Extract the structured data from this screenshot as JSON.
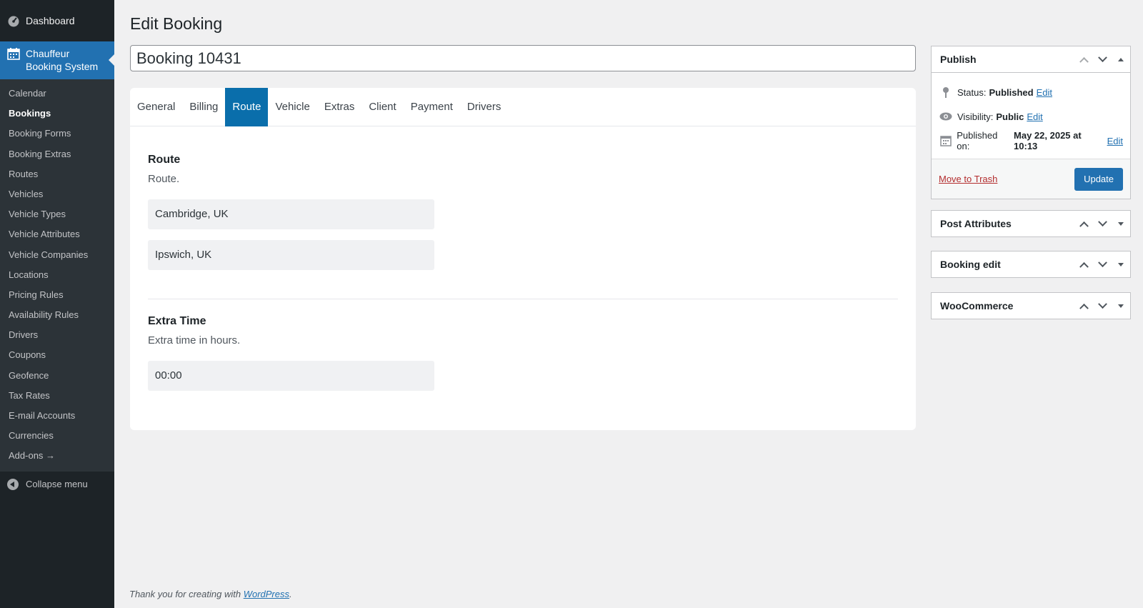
{
  "sidebar": {
    "dashboard_label": "Dashboard",
    "plugin_label": "Chauffeur Booking System",
    "items": [
      {
        "label": "Calendar"
      },
      {
        "label": "Bookings"
      },
      {
        "label": "Booking Forms"
      },
      {
        "label": "Booking Extras"
      },
      {
        "label": "Routes"
      },
      {
        "label": "Vehicles"
      },
      {
        "label": "Vehicle Types"
      },
      {
        "label": "Vehicle Attributes"
      },
      {
        "label": "Vehicle Companies"
      },
      {
        "label": "Locations"
      },
      {
        "label": "Pricing Rules"
      },
      {
        "label": "Availability Rules"
      },
      {
        "label": "Drivers"
      },
      {
        "label": "Coupons"
      },
      {
        "label": "Geofence"
      },
      {
        "label": "Tax Rates"
      },
      {
        "label": "E-mail Accounts"
      },
      {
        "label": "Currencies"
      },
      {
        "label": "Add-ons →"
      }
    ],
    "current_item": "Bookings",
    "collapse_label": "Collapse menu"
  },
  "page": {
    "title": "Edit Booking",
    "post_title_value": "Booking 10431"
  },
  "tabs": [
    "General",
    "Billing",
    "Route",
    "Vehicle",
    "Extras",
    "Client",
    "Payment",
    "Drivers"
  ],
  "active_tab": "Route",
  "route_section": {
    "title": "Route",
    "description": "Route.",
    "from": "Cambridge, UK",
    "to": "Ipswich, UK"
  },
  "extra_time_section": {
    "title": "Extra Time",
    "description": "Extra time in hours.",
    "value": "00:00"
  },
  "publish_box": {
    "title": "Publish",
    "status_label": "Status:",
    "status_value": "Published",
    "visibility_label": "Visibility:",
    "visibility_value": "Public",
    "published_label": "Published on:",
    "published_value": "May 22, 2025 at 10:13",
    "edit_link": "Edit",
    "trash_link": "Move to Trash",
    "update_button": "Update"
  },
  "meta_boxes": [
    {
      "title": "Post Attributes"
    },
    {
      "title": "Booking edit"
    },
    {
      "title": "WooCommerce"
    }
  ],
  "footer": {
    "text": "Thank you for creating with",
    "link": "WordPress",
    "trailing": "."
  },
  "colors": {
    "sidebar_bg": "#1d2327",
    "submenu_bg": "#2c3338",
    "accent": "#2271b1",
    "active_tab": "#0a6eab",
    "trash": "#b32d2e"
  }
}
